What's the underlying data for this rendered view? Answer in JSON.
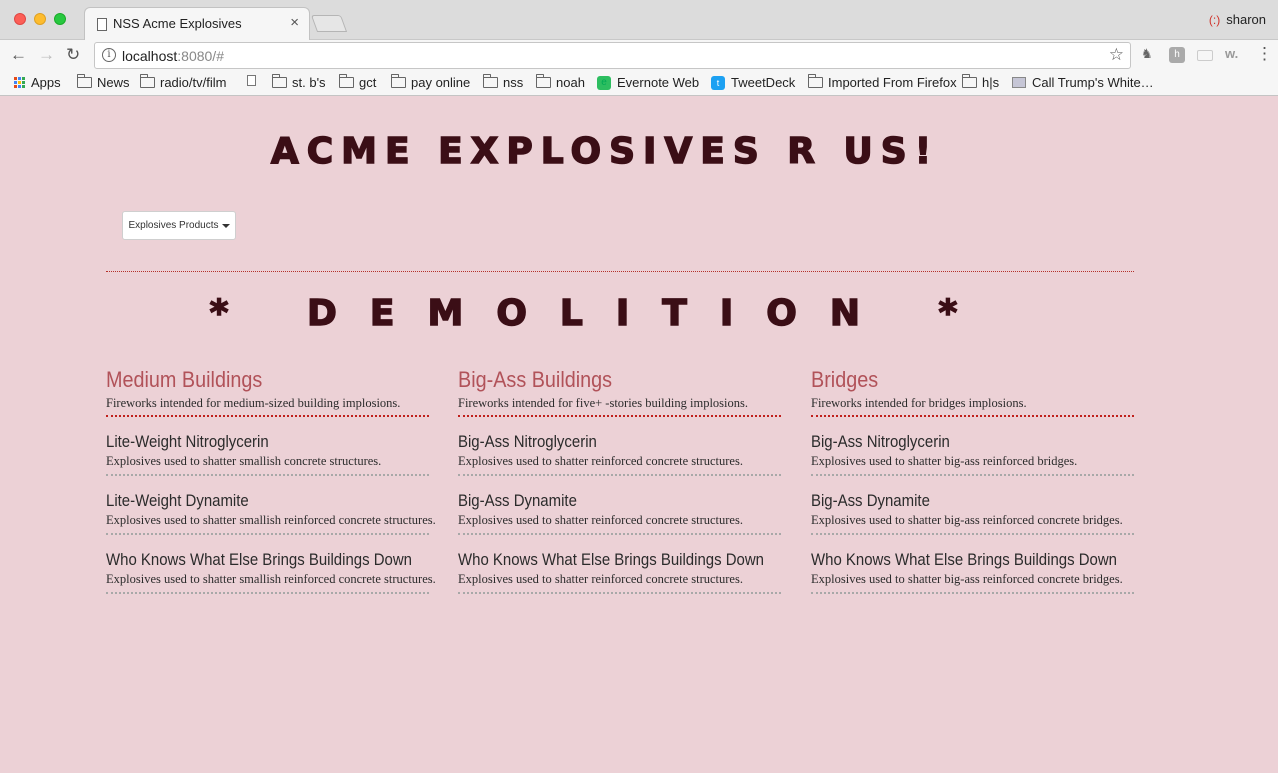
{
  "browser": {
    "tab_title": "NSS Acme Explosives",
    "profile_name": "sharon",
    "url_host": "localhost",
    "url_rest": ":8080/#",
    "bookmarks": [
      {
        "label": "Apps",
        "icon": "apps-grid-icon"
      },
      {
        "label": "News",
        "icon": "folder-icon"
      },
      {
        "label": "radio/tv/film",
        "icon": "folder-icon"
      },
      {
        "label": "",
        "icon": "page-icon"
      },
      {
        "label": "st. b's",
        "icon": "folder-icon"
      },
      {
        "label": "gct",
        "icon": "folder-icon"
      },
      {
        "label": "pay online",
        "icon": "folder-icon"
      },
      {
        "label": "nss",
        "icon": "folder-icon"
      },
      {
        "label": "noah",
        "icon": "folder-icon"
      },
      {
        "label": "Evernote Web",
        "icon": "evernote-icon"
      },
      {
        "label": "TweetDeck",
        "icon": "twitter-icon"
      },
      {
        "label": "Imported From Firefox",
        "icon": "folder-icon"
      },
      {
        "label": "h|s",
        "icon": "folder-icon"
      },
      {
        "label": "Call Trump's White…",
        "icon": "gov-icon"
      }
    ]
  },
  "page": {
    "title": "ACME EXPLOSIVES R US!",
    "dropdown_label": "Explosives Products",
    "section_heading": "* DEMOLITION *",
    "colors": {
      "background": "#ecd1d6",
      "heading": "#3b0e16",
      "category_title": "#b15259",
      "category_rule": "#c0201c"
    },
    "categories": [
      {
        "title": "Medium Buildings",
        "description": "Fireworks intended for medium-sized building implosions.",
        "products": [
          {
            "name": "Lite-Weight Nitroglycerin",
            "description": "Explosives used to shatter smallish concrete structures."
          },
          {
            "name": "Lite-Weight Dynamite",
            "description": "Explosives used to shatter smallish reinforced concrete structures."
          },
          {
            "name": "Who Knows What Else Brings Buildings Down",
            "description": "Explosives used to shatter smallish reinforced concrete structures."
          }
        ]
      },
      {
        "title": "Big-Ass Buildings",
        "description": "Fireworks intended for five+ -stories building implosions.",
        "products": [
          {
            "name": "Big-Ass Nitroglycerin",
            "description": "Explosives used to shatter reinforced concrete structures."
          },
          {
            "name": "Big-Ass Dynamite",
            "description": "Explosives used to shatter reinforced concrete structures."
          },
          {
            "name": "Who Knows What Else Brings Buildings Down",
            "description": "Explosives used to shatter reinforced concrete structures."
          }
        ]
      },
      {
        "title": "Bridges",
        "description": "Fireworks intended for bridges implosions.",
        "products": [
          {
            "name": "Big-Ass Nitroglycerin",
            "description": "Explosives used to shatter big-ass reinforced bridges."
          },
          {
            "name": "Big-Ass Dynamite",
            "description": "Explosives used to shatter big-ass reinforced concrete bridges."
          },
          {
            "name": "Who Knows What Else Brings Buildings Down",
            "description": "Explosives used to shatter big-ass reinforced concrete bridges."
          }
        ]
      }
    ]
  }
}
